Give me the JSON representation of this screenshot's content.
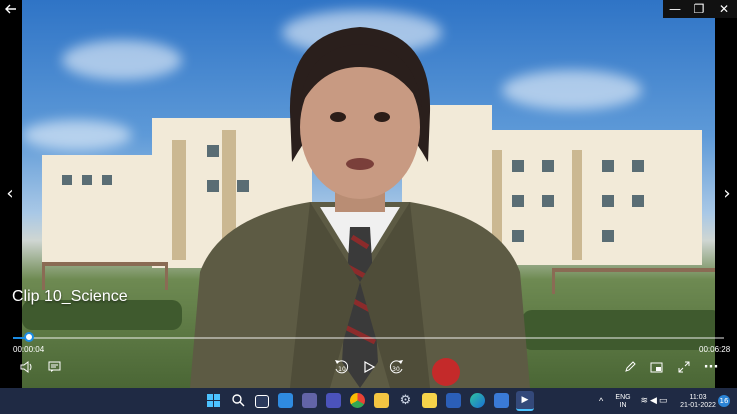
{
  "window": {
    "minimize_glyph": "—",
    "maximize_glyph": "❐",
    "close_glyph": "✕"
  },
  "video": {
    "title": "Clip 10_Science",
    "progress": 0.022
  },
  "nav": {
    "prev_glyph": "‹",
    "next_glyph": "›"
  },
  "timeline": {
    "elapsed": "00:00:04",
    "total": "00:06:28"
  },
  "controls": {
    "volume_icon": "volume-icon",
    "captions_icon": "captions-icon",
    "skip_back_label": "10",
    "skip_forward_label": "30",
    "edit_icon": "pen-icon",
    "miniplayer_icon": "miniplayer-icon",
    "fullscreen_icon": "fullscreen-icon",
    "more_glyph": "···"
  },
  "taskbar": {
    "tray": {
      "language": "ENG",
      "region": "IN",
      "time": "11:03",
      "date": "21-01-2022",
      "notifications": "16"
    },
    "chevron_glyph": "^"
  },
  "colors": {
    "accent": "#1b8ce3",
    "taskbar": "#1f2a44"
  }
}
